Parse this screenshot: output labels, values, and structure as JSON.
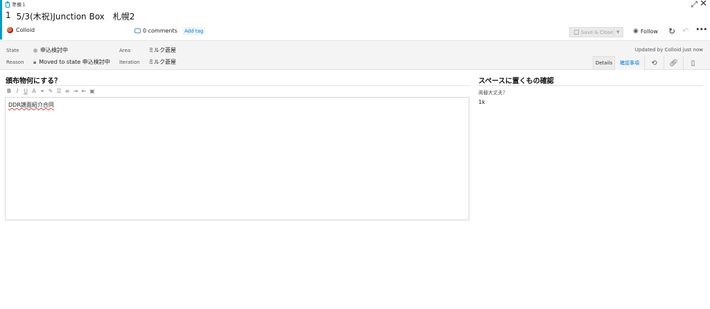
{
  "header": {
    "work_item_type": "準備１",
    "id": "1",
    "title": "5/3(木祝)Junction Box　札幌2",
    "owner": "Colloid",
    "comments": "0 comments",
    "add_tag": "Add tag",
    "save_close": "Save & Close",
    "follow": "Follow"
  },
  "fields": {
    "state_label": "State",
    "state_value": "申込検討中",
    "reason_label": "Reason",
    "reason_value": "Moved to state 申込検討中",
    "area_label": "Area",
    "area_value": "ミルク蒼屋",
    "iteration_label": "Iteration",
    "iteration_value": "ミルク蒼屋",
    "updated": "Updated by Colloid just now"
  },
  "tabs": [
    {
      "label": "Details"
    },
    {
      "label": "確認事項",
      "active": true
    }
  ],
  "left_section": {
    "title": "頒布物何にする？",
    "editor_content": "DDR譜面紹介合同"
  },
  "right_section": {
    "title": "スペースに置くもの確認",
    "field_label": "両替大丈夫？",
    "field_value": "1k"
  },
  "colors": {
    "accent": "#009ccc",
    "link": "#0078d4"
  },
  "icons": [
    "clipboard-icon",
    "expand-icon",
    "close-icon",
    "comment-icon",
    "save-icon",
    "eye-icon",
    "refresh-icon",
    "undo-icon",
    "more-icon",
    "lock-icon",
    "history-icon",
    "link-icon",
    "attachment-icon"
  ]
}
